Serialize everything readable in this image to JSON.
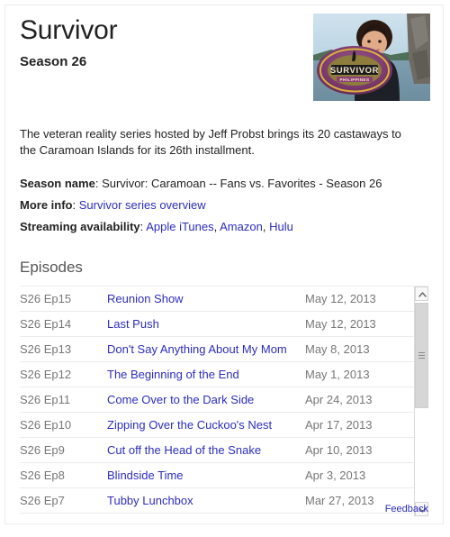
{
  "card": {
    "title": "Survivor",
    "subtitle": "Season 26",
    "thumbnail_alt": "Jeff Probst with Survivor Philippines logo",
    "description": "The veteran reality series hosted by Jeff Probst brings its 20 castaways to the Caramoan Islands for its 26th installment."
  },
  "facts": [
    {
      "label": "Season name",
      "separator": ":",
      "value": "Survivor: Caramoan -- Fans vs. Favorites - Season 26",
      "links": []
    },
    {
      "label": "More info",
      "separator": ":",
      "value": "",
      "links": [
        "Survivor series overview"
      ]
    },
    {
      "label": "Streaming availability",
      "separator": ":",
      "value": "",
      "links": [
        "Apple iTunes",
        "Amazon",
        "Hulu"
      ]
    }
  ],
  "episodes": {
    "heading": "Episodes",
    "rows": [
      {
        "id": "S26 Ep15",
        "title": "Reunion Show",
        "date": "May 12, 2013"
      },
      {
        "id": "S26 Ep14",
        "title": "Last Push",
        "date": "May 12, 2013"
      },
      {
        "id": "S26 Ep13",
        "title": "Don't Say Anything About My Mom",
        "date": "May 8, 2013"
      },
      {
        "id": "S26 Ep12",
        "title": "The Beginning of the End",
        "date": "May 1, 2013"
      },
      {
        "id": "S26 Ep11",
        "title": "Come Over to the Dark Side",
        "date": "Apr 24, 2013"
      },
      {
        "id": "S26 Ep10",
        "title": "Zipping Over the Cuckoo's Nest",
        "date": "Apr 17, 2013"
      },
      {
        "id": "S26 Ep9",
        "title": "Cut off the Head of the Snake",
        "date": "Apr 10, 2013"
      },
      {
        "id": "S26 Ep8",
        "title": "Blindside Time",
        "date": "Apr 3, 2013"
      },
      {
        "id": "S26 Ep7",
        "title": "Tubby Lunchbox",
        "date": "Mar 27, 2013"
      }
    ]
  },
  "scrollbar": {
    "up_icon": "chevron-up-icon",
    "down_icon": "chevron-down-icon"
  },
  "footer": {
    "feedback_label": "Feedback"
  },
  "colors": {
    "link": "#2d2dbd",
    "text": "#222222",
    "muted": "#777777",
    "border": "#ebebeb"
  }
}
